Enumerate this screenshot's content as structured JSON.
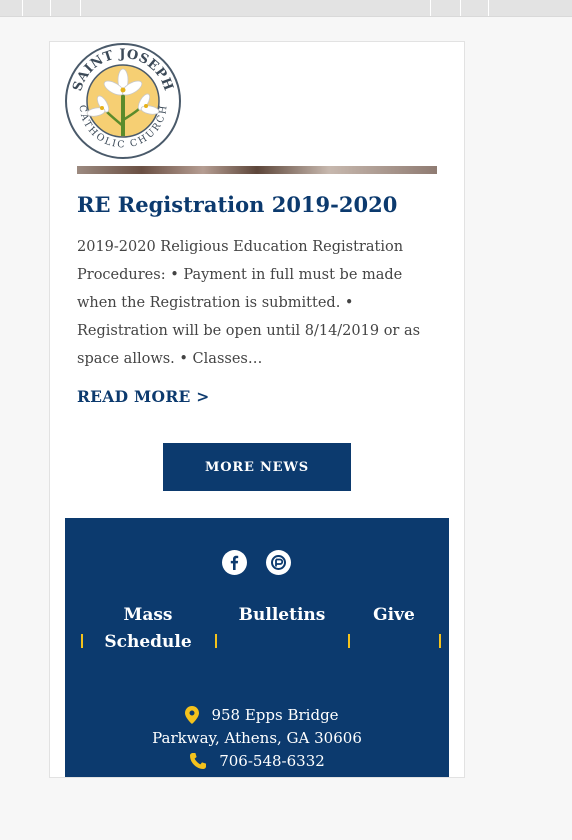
{
  "logo": {
    "name_top": "SAINT JOSEPH",
    "name_bottom": "CATHOLIC CHURCH",
    "colors": {
      "ring": "#4a5a6a",
      "fill": "#f6cf73",
      "lily": "#ffffff",
      "stem": "#5b8b2b"
    }
  },
  "post": {
    "title": "RE Registration 2019-2020",
    "excerpt": "2019-2020 Religious Education Registration Procedures: • Payment in full must be made when the Registration is submitted. • Registration will be open until 8/14/2019 or as space allows. • Classes…",
    "read_more": "READ MORE >"
  },
  "more_news_label": "MORE NEWS",
  "footer": {
    "social": [
      {
        "icon": "facebook-icon"
      },
      {
        "icon": "flocknote-icon"
      }
    ],
    "nav": [
      {
        "label": "Mass Schedule"
      },
      {
        "label": "Bulletins"
      },
      {
        "label": "Give"
      }
    ],
    "address_line1": "958 Epps Bridge",
    "address_line2": "Parkway, Athens, GA 30606",
    "phone": "706-548-6332"
  },
  "colors": {
    "brand_navy": "#0c3a6e",
    "accent_gold": "#f4c21c",
    "text_gray": "#444444"
  }
}
